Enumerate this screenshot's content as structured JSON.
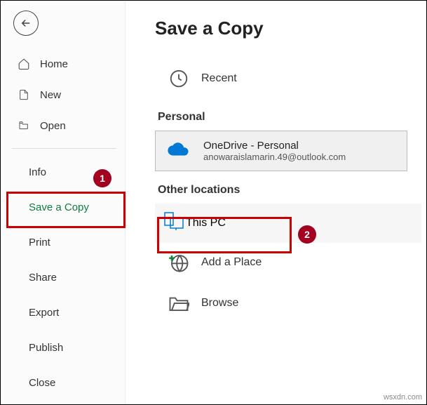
{
  "page_title": "Save a Copy",
  "sidebar": {
    "nav": [
      {
        "label": "Home"
      },
      {
        "label": "New"
      },
      {
        "label": "Open"
      }
    ],
    "sub": [
      {
        "label": "Info"
      },
      {
        "label": "Save a Copy",
        "selected": true
      },
      {
        "label": "Print"
      },
      {
        "label": "Share"
      },
      {
        "label": "Export"
      },
      {
        "label": "Publish"
      },
      {
        "label": "Close"
      }
    ]
  },
  "locations": {
    "recent_label": "Recent",
    "personal_header": "Personal",
    "onedrive_title": "OneDrive - Personal",
    "onedrive_email": "anowaraislamarin.49@outlook.com",
    "other_header": "Other locations",
    "thispc_label": "This PC",
    "addplace_label": "Add a Place",
    "browse_label": "Browse"
  },
  "annotations": {
    "badge1": "1",
    "badge2": "2"
  },
  "watermark": "wsxdn.com",
  "colors": {
    "accent_green": "#0f7b3e",
    "highlight_red": "#cc0000",
    "badge_bg": "#a40020",
    "onedrive_blue": "#0078d4"
  }
}
